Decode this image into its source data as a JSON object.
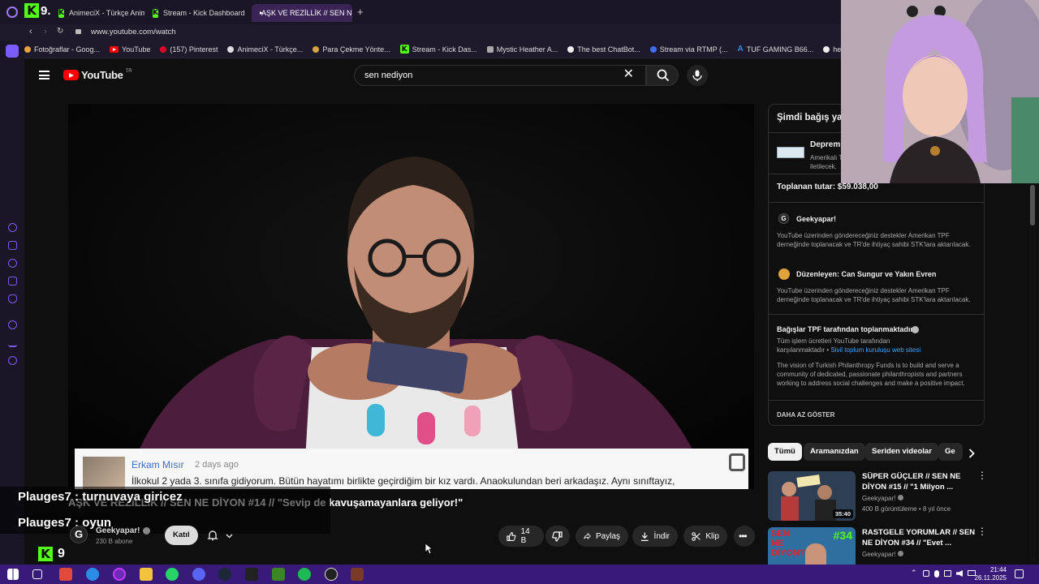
{
  "browser": {
    "tabs": [
      {
        "label": "AnimeciX - Türkçe Anime",
        "icon": "kick-icon"
      },
      {
        "label": "Stream - Kick Dashboard",
        "icon": "kick-icon"
      },
      {
        "label": "AŞK VE REZİLLİK // SEN N",
        "icon": "youtube-icon",
        "active": true
      }
    ],
    "tab_number": "9.",
    "url": "www.youtube.com/watch",
    "bookmarks": [
      "Fotoğraflar - Goog...",
      "YouTube",
      "(157) Pinterest",
      "AnimeciX - Türkçe...",
      "Para Çekme Yönte...",
      "Stream - Kick Das...",
      "Mystic Heather A...",
      "The best ChatBot...",
      "Stream via RTMP (...",
      "TUF GAMING B66...",
      "hervora"
    ]
  },
  "youtube": {
    "logo_text": "YouTube",
    "logo_sup": "TR",
    "search_query": "sen nediyon"
  },
  "video": {
    "comment": {
      "author": "Erkam Mısır",
      "date": "2 days ago",
      "text": "İlkokul 2 yada 3. sınıfa gidiyorum. Bütün hayatımı birlikte geçirdiğim bir kız vardı. Anaokulundan beri arkadaşız. Aynı sınıftayız,"
    },
    "title": "AŞK VE REZİLLİK // SEN NE DİYON #14 // \"Sevip de kavuşamayanlara geliyor!\"",
    "channel": "Geekyapar!",
    "subscribers": "230 B abone",
    "join_label": "Katıl",
    "likes": "14 B",
    "share_label": "Paylaş",
    "download_label": "İndir",
    "clip_label": "Klip"
  },
  "chat": [
    {
      "user": "Plauges7",
      "message": "turnuvaya giricez"
    },
    {
      "user": "Plauges7",
      "message": "oyun"
    }
  ],
  "kick_overlay": {
    "number": "9"
  },
  "donation": {
    "heading": "Şimdi bağış ya",
    "campaign_title": "Deprem",
    "campaign_desc_1": "Amerikalı T",
    "campaign_desc_2": "iletilecek.",
    "raised_label": "Toplanan tutar: $59.038,00",
    "org1_name": "Geekyapar!",
    "org1_desc": "YouTube üzerinden göndereceğiniz destekler Amerikan TPF derneğinde toplanacak ve TR'de ihtiyaç sahibi STK'lara aktarılacak.",
    "org2_name": "Düzenleyen: Can Sungur ve Yakın Evren",
    "org2_desc": "YouTube üzerinden göndereceğiniz destekler Amerikan TPF derneğinde toplanacak ve TR'de ihtiyaç sahibi STK'lara aktarılacak.",
    "tpf_title": "Bağışlar TPF tarafından toplanmaktadır",
    "tpf_desc": "Tüm işlem ücretleri YouTube tarafından karşılanmaktadır",
    "tpf_link": "Sivil toplum kuruluşu web sitesi",
    "vision": "The vision of Turkish Philanthropy Funds is to build and serve a community of dedicated, passionate philanthropists and partners working to address social challenges and make a positive impact.",
    "show_less": "DAHA AZ GÖSTER"
  },
  "chips": [
    "Tümü",
    "Aramanızdan",
    "Seriden videolar",
    "Ge"
  ],
  "recommendations": [
    {
      "title": "SÜPER GÜÇLER // SEN NE DİYON #15 // \"1 Milyon ...",
      "channel": "Geekyapar!",
      "meta": "400 B görüntüleme • 8 yıl önce",
      "duration": "35:40"
    },
    {
      "title": "RASTGELE YORUMLAR // SEN NE DİYON #34 // \"Evet ...",
      "channel": "Geekyapar!",
      "meta": "",
      "thumb_text": "SEN NE DİYON?",
      "thumb_num": "#34"
    }
  ],
  "taskbar": {
    "time": "21:44",
    "date": "26.11.2025"
  },
  "colors": {
    "accent": "#53fc18",
    "youtube_red": "#ff0000",
    "opera_purple": "#7b5cff",
    "taskbar": "#3a1a78"
  }
}
